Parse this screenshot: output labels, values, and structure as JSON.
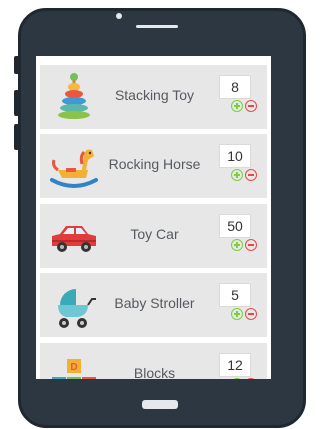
{
  "items": [
    {
      "name": "Stacking Toy",
      "qty": "8",
      "icon": "stacking-toy-icon"
    },
    {
      "name": "Rocking Horse",
      "qty": "10",
      "icon": "rocking-horse-icon"
    },
    {
      "name": "Toy Car",
      "qty": "50",
      "icon": "toy-car-icon"
    },
    {
      "name": "Baby Stroller",
      "qty": "5",
      "icon": "baby-stroller-icon"
    },
    {
      "name": "Blocks",
      "qty": "12",
      "icon": "blocks-icon"
    }
  ],
  "block_letter": "D",
  "colors": {
    "device": "#2d3742",
    "row_bg": "#e7e7e7",
    "plus": "#7ccf40",
    "minus": "#e84848"
  }
}
